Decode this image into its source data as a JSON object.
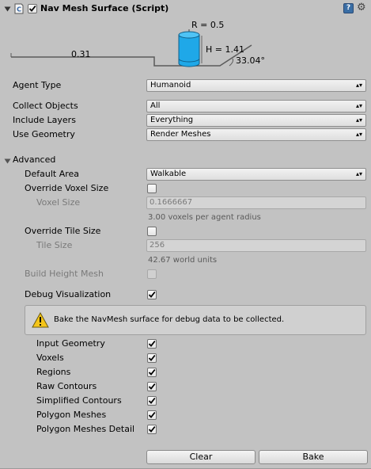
{
  "header": {
    "title": "Nav Mesh Surface (Script)",
    "enabled": true,
    "icons": [
      "script-icon",
      "help-icon",
      "gear-icon",
      "foldout-arrow-icon"
    ]
  },
  "diagram": {
    "radius_label": "R = 0.5",
    "height_label": "H = 1.41",
    "step_label": "0.31",
    "slope_label": "33.04°",
    "cylinder_color": "#1fa8e8"
  },
  "fields": {
    "agent_type": {
      "label": "Agent Type",
      "value": "Humanoid"
    },
    "collect_objects": {
      "label": "Collect Objects",
      "value": "All"
    },
    "include_layers": {
      "label": "Include Layers",
      "value": "Everything"
    },
    "use_geometry": {
      "label": "Use Geometry",
      "value": "Render Meshes"
    }
  },
  "advanced": {
    "label": "Advanced",
    "expanded": true,
    "default_area": {
      "label": "Default Area",
      "value": "Walkable"
    },
    "override_voxel_size": {
      "label": "Override Voxel Size",
      "checked": false
    },
    "voxel_size": {
      "label": "Voxel Size",
      "value": "0.1666667",
      "hint": "3.00 voxels per agent radius"
    },
    "override_tile_size": {
      "label": "Override Tile Size",
      "checked": false
    },
    "tile_size": {
      "label": "Tile Size",
      "value": "256",
      "hint": "42.67 world units"
    },
    "build_height_mesh": {
      "label": "Build Height Mesh",
      "checked": false,
      "disabled": true
    }
  },
  "debug": {
    "label": "Debug Visualization",
    "checked": true,
    "help_message": "Bake the NavMesh surface for debug data to be collected.",
    "help_icon": "warning-icon",
    "options": [
      {
        "label": "Input Geometry",
        "checked": true
      },
      {
        "label": "Voxels",
        "checked": true
      },
      {
        "label": "Regions",
        "checked": true
      },
      {
        "label": "Raw Contours",
        "checked": true
      },
      {
        "label": "Simplified Contours",
        "checked": true
      },
      {
        "label": "Polygon Meshes",
        "checked": true
      },
      {
        "label": "Polygon Meshes Detail",
        "checked": true
      }
    ]
  },
  "buttons": {
    "clear": "Clear",
    "bake": "Bake"
  }
}
